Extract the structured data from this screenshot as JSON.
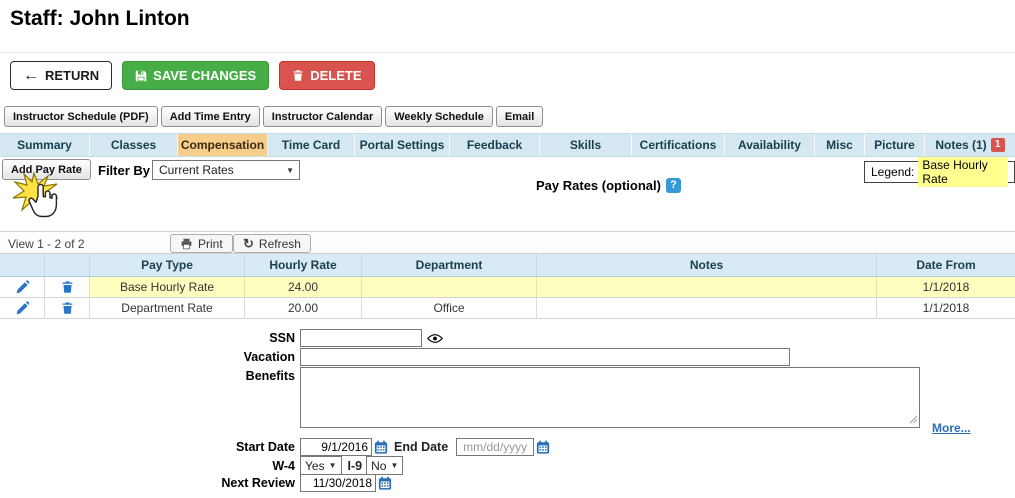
{
  "header": {
    "title": "Staff: John Linton"
  },
  "actions": {
    "return": "RETURN",
    "save": "SAVE CHANGES",
    "delete": "DELETE"
  },
  "quick_links": [
    {
      "label": "Instructor Schedule (PDF)"
    },
    {
      "label": "Add Time Entry"
    },
    {
      "label": "Instructor Calendar"
    },
    {
      "label": "Weekly Schedule"
    },
    {
      "label": "Email"
    }
  ],
  "tabs": [
    {
      "label": "Summary"
    },
    {
      "label": "Classes"
    },
    {
      "label": "Compensation",
      "active": true
    },
    {
      "label": "Time Card"
    },
    {
      "label": "Portal Settings"
    },
    {
      "label": "Feedback"
    },
    {
      "label": "Skills"
    },
    {
      "label": "Certifications"
    },
    {
      "label": "Availability"
    },
    {
      "label": "Misc"
    },
    {
      "label": "Picture"
    },
    {
      "label": "Notes (1)",
      "badge": "1"
    }
  ],
  "pay_rates": {
    "add_button": "Add Pay Rate",
    "filter_label": "Filter By",
    "filter_value": "Current Rates",
    "title": "Pay Rates (optional)",
    "legend_label": "Legend:",
    "legend_value": "Base Hourly Rate",
    "view_text": "View 1 - 2 of 2",
    "print_button": "Print",
    "refresh_button": "Refresh",
    "columns": [
      "Pay Type",
      "Hourly Rate",
      "Department",
      "Notes",
      "Date From"
    ],
    "rows": [
      {
        "pay_type": "Base Hourly Rate",
        "hourly_rate": "24.00",
        "department": "",
        "notes": "",
        "date_from": "1/1/2018",
        "highlighted": true
      },
      {
        "pay_type": "Department Rate",
        "hourly_rate": "20.00",
        "department": "Office",
        "notes": "",
        "date_from": "1/1/2018",
        "highlighted": false
      }
    ]
  },
  "form": {
    "ssn_label": "SSN",
    "ssn_value": "",
    "vacation_label": "Vacation",
    "vacation_value": "",
    "benefits_label": "Benefits",
    "benefits_value": "",
    "more_link": "More...",
    "start_date_label": "Start Date",
    "start_date_value": "9/1/2016",
    "end_date_label": "End Date",
    "end_date_placeholder": "mm/dd/yyyy",
    "w4_label": "W-4",
    "w4_value": "Yes",
    "i9_label": "I-9",
    "i9_value": "No",
    "next_review_label": "Next Review",
    "next_review_value": "11/30/2018"
  },
  "colors": {
    "save_green": "#47ad47",
    "delete_red": "#d9534f",
    "tab_bar_blue": "#d5e8f2",
    "active_tab_orange": "#f6cd8b",
    "table_header_blue": "#d7eaf5",
    "highlight_yellow": "#feffbe",
    "legend_yellow": "#feff8f",
    "link_blue": "#2a6fb5",
    "icon_blue": "#2a75c9"
  }
}
